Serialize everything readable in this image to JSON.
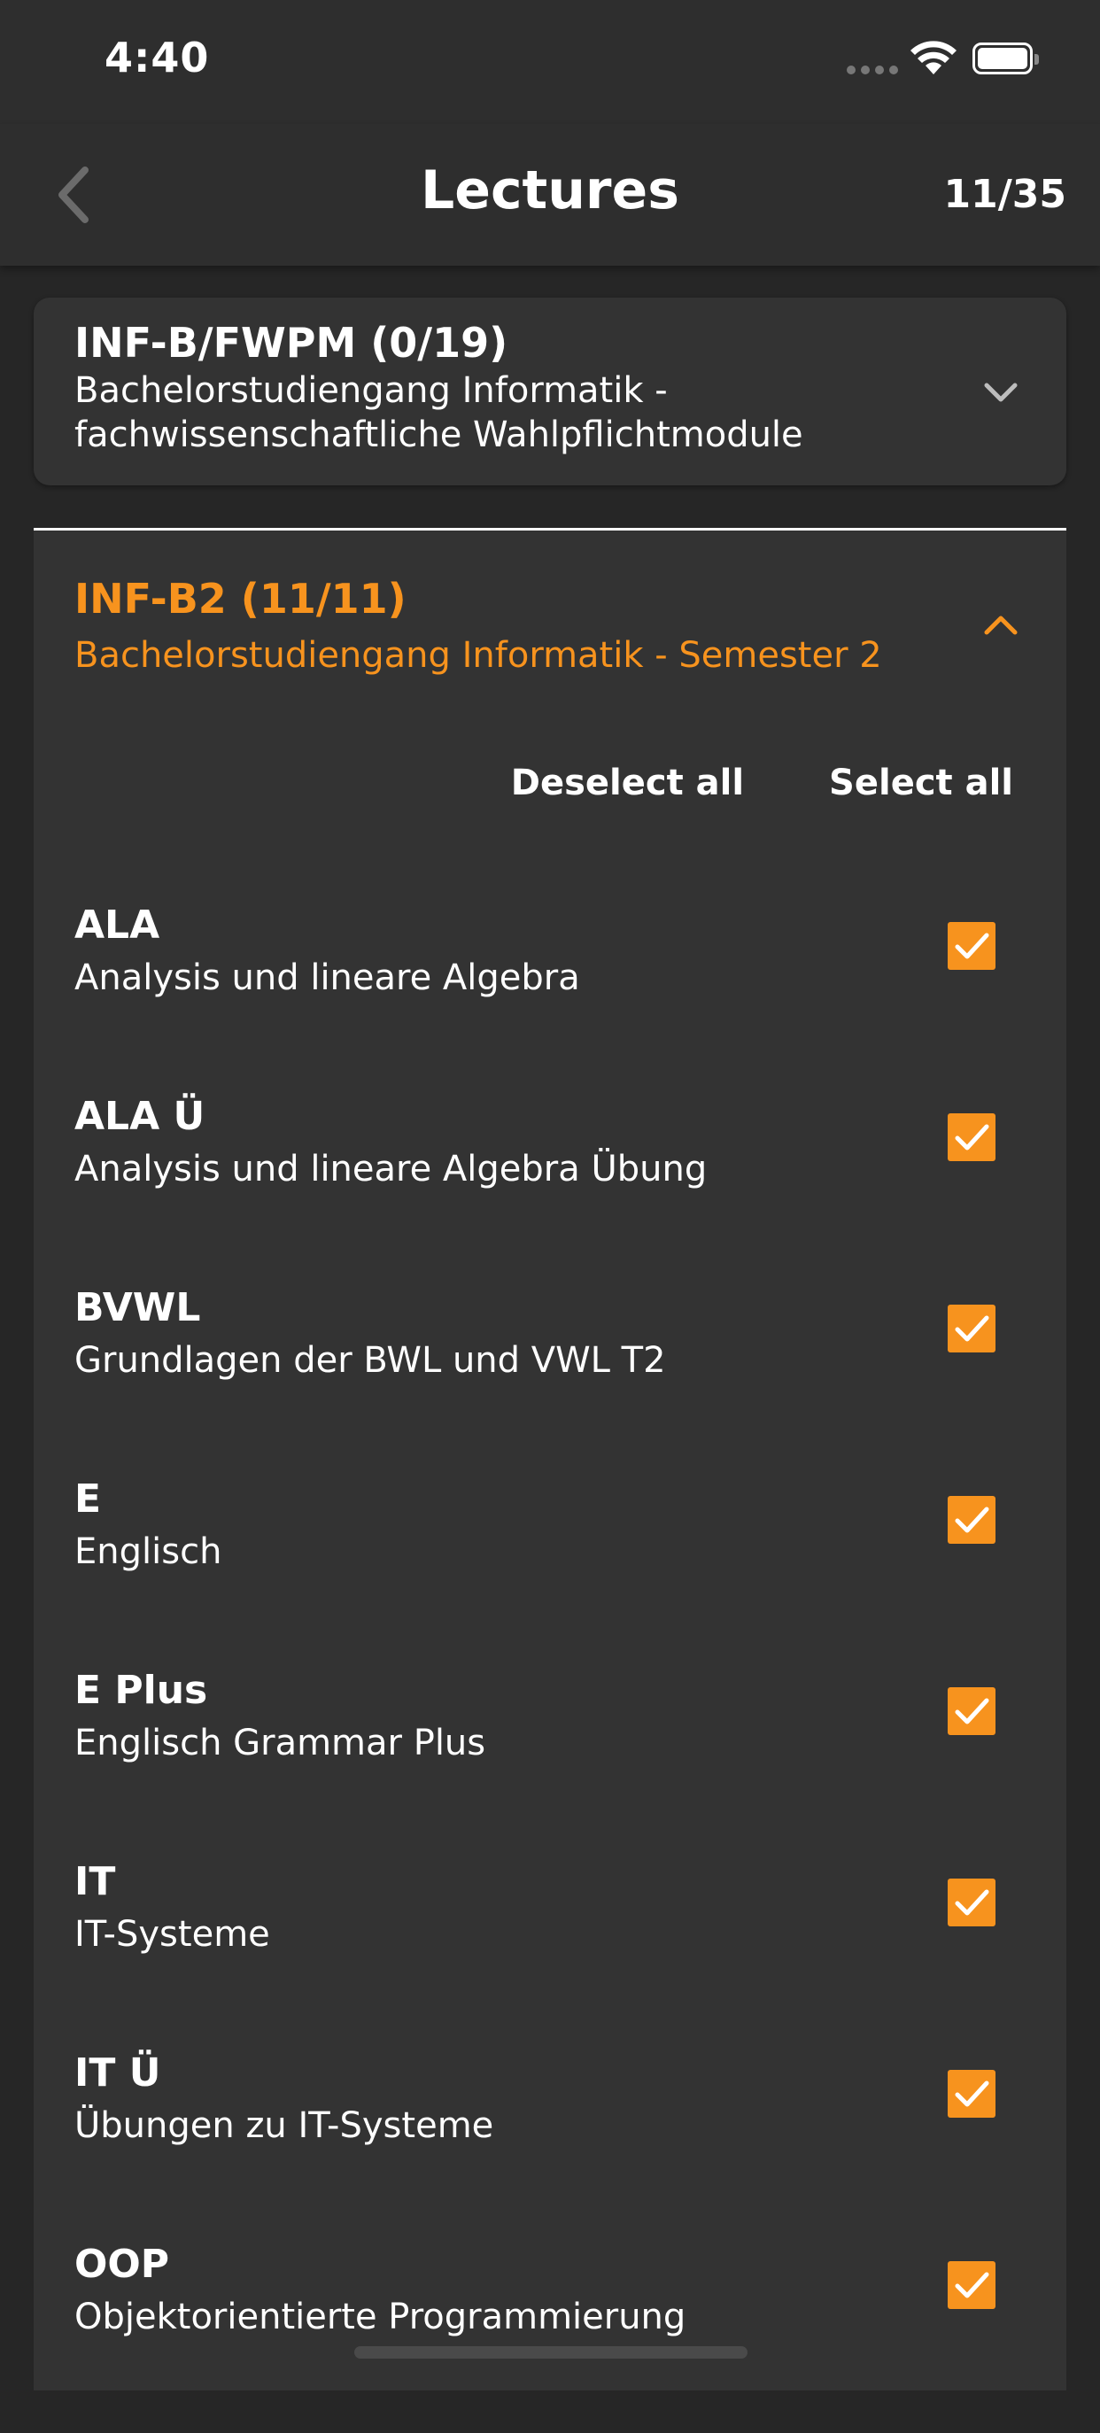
{
  "status_bar": {
    "time": "4:40"
  },
  "nav": {
    "title": "Lectures",
    "count": "11/35",
    "back_icon": "chevron-left-icon"
  },
  "colors": {
    "accent": "#f7931e",
    "background": "#262626",
    "card": "#333333"
  },
  "groups": [
    {
      "code": "INF-B/FWPM (0/19)",
      "name": "Bachelorstudiengang Informatik - fachwissenschaftliche Wahlpflichtmodule",
      "expanded": false
    },
    {
      "code": "INF-B2 (11/11)",
      "name": "Bachelorstudiengang Informatik - Semester 2",
      "expanded": true,
      "deselect_all_label": "Deselect all",
      "select_all_label": "Select all",
      "lectures": [
        {
          "code": "ALA",
          "name": "Analysis und lineare Algebra",
          "checked": true
        },
        {
          "code": "ALA Ü",
          "name": "Analysis und lineare Algebra Übung",
          "checked": true
        },
        {
          "code": "BVWL",
          "name": "Grundlagen der BWL und VWL T2",
          "checked": true
        },
        {
          "code": "E",
          "name": "Englisch",
          "checked": true
        },
        {
          "code": "E Plus",
          "name": "Englisch Grammar Plus",
          "checked": true
        },
        {
          "code": "IT",
          "name": "IT-Systeme",
          "checked": true
        },
        {
          "code": "IT Ü",
          "name": "Übungen zu IT-Systeme",
          "checked": true
        },
        {
          "code": "OOP",
          "name": "Objektorientierte Programmierung",
          "checked": true
        }
      ]
    }
  ]
}
